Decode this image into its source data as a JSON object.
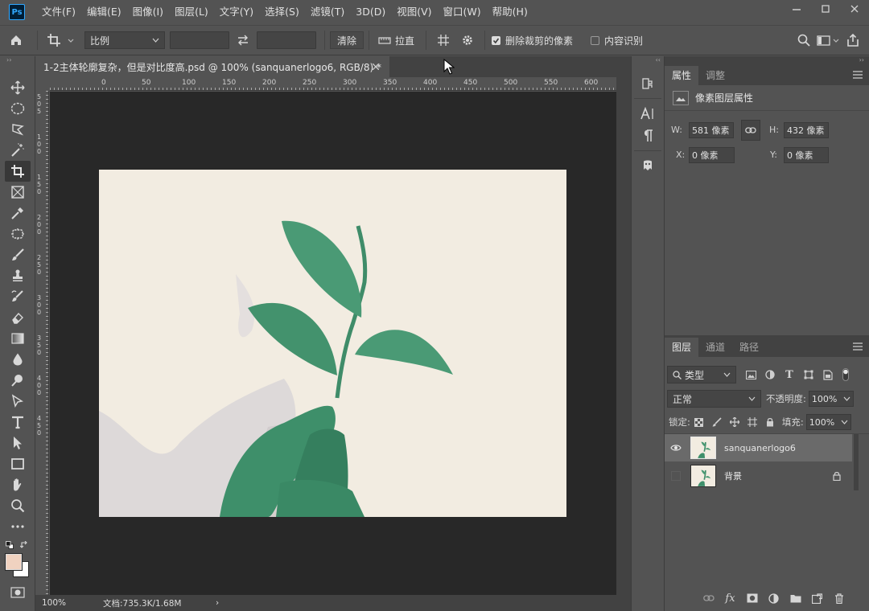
{
  "menubar": {
    "logo": "Ps",
    "items": [
      "文件(F)",
      "编辑(E)",
      "图像(I)",
      "图层(L)",
      "文字(Y)",
      "选择(S)",
      "滤镜(T)",
      "3D(D)",
      "视图(V)",
      "窗口(W)",
      "帮助(H)"
    ],
    "window_controls": [
      "minimize-icon",
      "restore-icon",
      "close-icon"
    ]
  },
  "options": {
    "ratio_select": "比例",
    "ratio_width": "",
    "ratio_height": "",
    "clear_label": "清除",
    "straighten_label": "拉直",
    "delete_cropped_label": "删除裁剪的像素",
    "delete_cropped_checked": true,
    "content_aware_label": "内容识别",
    "content_aware_checked": false
  },
  "tools": [
    "move-icon",
    "ellipse-marquee-icon",
    "lasso-icon",
    "magic-wand-icon",
    "crop-icon",
    "frame-icon",
    "eyedropper-icon",
    "patch-icon",
    "brush-icon",
    "clone-stamp-icon",
    "history-brush-icon",
    "eraser-icon",
    "gradient-icon",
    "blur-icon",
    "dodge-icon",
    "pen-icon",
    "type-icon",
    "path-select-icon",
    "rectangle-icon",
    "hand-icon",
    "zoom-icon",
    "more-icon"
  ],
  "active_tool": "crop-icon",
  "colors": {
    "foreground": "#f0d2c0",
    "background": "#ffffff",
    "accent": "#31a8ff",
    "canvas_bg": "#f2ece1",
    "leaf": "#3f9570"
  },
  "document": {
    "tab_title": "1-2主体轮廓复杂，但是对比度高.psd @ 100% (sanquanerlogo6, RGB/8) *",
    "ruler_h_labels": [
      "0",
      "50",
      "100",
      "150",
      "200",
      "250",
      "300",
      "350",
      "400",
      "450",
      "500",
      "550",
      "600"
    ],
    "ruler_v_labels": [
      "5",
      "0",
      "5",
      "1",
      "0",
      "0",
      "1",
      "5",
      "0",
      "2",
      "0",
      "0",
      "2",
      "5",
      "0",
      "3",
      "0",
      "0",
      "3",
      "5",
      "0",
      "4",
      "0",
      "0",
      "4",
      "5",
      "0"
    ],
    "zoom": "100%",
    "doc_info": "文档:735.3K/1.68M"
  },
  "properties": {
    "tabs": [
      "属性",
      "调整"
    ],
    "active_tab": "属性",
    "section_title": "像素图层属性",
    "w_label": "W:",
    "w_value": "581 像素",
    "h_label": "H:",
    "h_value": "432 像素",
    "x_label": "X:",
    "x_value": "0 像素",
    "y_label": "Y:",
    "y_value": "0 像素"
  },
  "layers_panel": {
    "tabs": [
      "图层",
      "通道",
      "路径"
    ],
    "active_tab": "图层",
    "filter_kind": "类型",
    "blend_mode": "正常",
    "opacity_label": "不透明度:",
    "opacity_value": "100%",
    "lock_label": "锁定:",
    "fill_label": "填充:",
    "fill_value": "100%",
    "layers": [
      {
        "name": "sanquanerlogo6",
        "visible": true,
        "selected": true,
        "locked": false
      },
      {
        "name": "背景",
        "visible": false,
        "selected": false,
        "locked": true
      }
    ]
  }
}
